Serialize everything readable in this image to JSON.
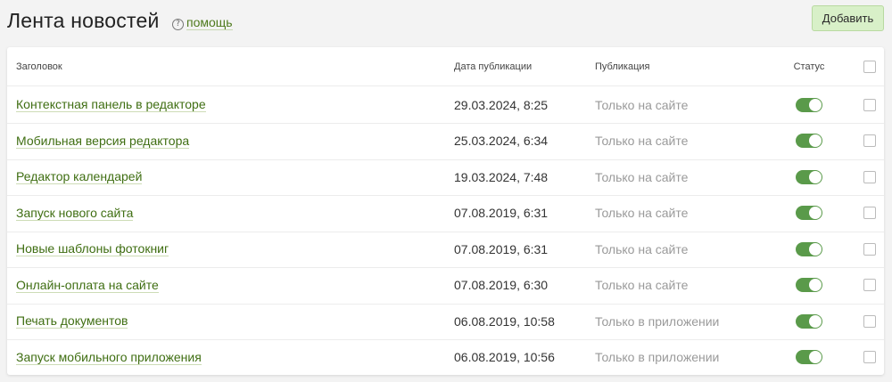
{
  "page": {
    "title": "Лента новостей",
    "help_label": "помощь",
    "help_icon": "question-circle-icon",
    "add_button_label": "Добавить"
  },
  "colors": {
    "accent_link": "#3f6e12",
    "add_button_bg": "#d8f0c8",
    "toggle_on": "#5a9a4a"
  },
  "table": {
    "columns": [
      "Заголовок",
      "Дата публикации",
      "Публикация",
      "Статус"
    ],
    "rows": [
      {
        "title": "Контекстная панель в редакторе",
        "date": "29.03.2024, 8:25",
        "publication": "Только на сайте",
        "status_on": true,
        "checked": false
      },
      {
        "title": "Мобильная версия редактора",
        "date": "25.03.2024, 6:34",
        "publication": "Только на сайте",
        "status_on": true,
        "checked": false
      },
      {
        "title": "Редактор календарей",
        "date": "19.03.2024, 7:48",
        "publication": "Только на сайте",
        "status_on": true,
        "checked": false
      },
      {
        "title": "Запуск нового сайта",
        "date": "07.08.2019, 6:31",
        "publication": "Только на сайте",
        "status_on": true,
        "checked": false
      },
      {
        "title": "Новые шаблоны фотокниг",
        "date": "07.08.2019, 6:31",
        "publication": "Только на сайте",
        "status_on": true,
        "checked": false
      },
      {
        "title": "Онлайн-оплата на сайте",
        "date": "07.08.2019, 6:30",
        "publication": "Только на сайте",
        "status_on": true,
        "checked": false
      },
      {
        "title": "Печать документов",
        "date": "06.08.2019, 10:58",
        "publication": "Только в приложении",
        "status_on": true,
        "checked": false
      },
      {
        "title": "Запуск мобильного приложения",
        "date": "06.08.2019, 10:56",
        "publication": "Только в приложении",
        "status_on": true,
        "checked": false
      }
    ]
  }
}
